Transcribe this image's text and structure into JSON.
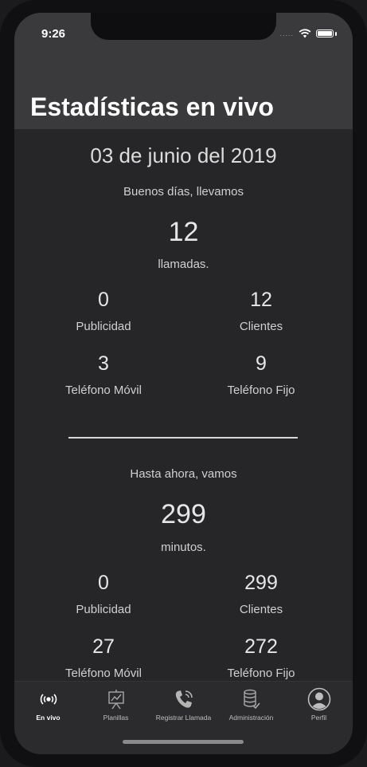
{
  "status_bar": {
    "time": "9:26",
    "signal": "....."
  },
  "header": {
    "title": "Estadísticas en vivo"
  },
  "main": {
    "date": "03 de junio del 2019",
    "calls": {
      "intro": "Buenos días, llevamos",
      "total": "12",
      "unit": "llamadas.",
      "stats": [
        {
          "value": "0",
          "label": "Publicidad"
        },
        {
          "value": "12",
          "label": "Clientes"
        },
        {
          "value": "3",
          "label": "Teléfono Móvil"
        },
        {
          "value": "9",
          "label": "Teléfono Fijo"
        }
      ]
    },
    "minutes": {
      "intro": "Hasta ahora, vamos",
      "total": "299",
      "unit": "minutos.",
      "stats": [
        {
          "value": "0",
          "label": "Publicidad"
        },
        {
          "value": "299",
          "label": "Clientes"
        },
        {
          "value": "27",
          "label": "Teléfono Móvil"
        },
        {
          "value": "272",
          "label": "Teléfono Fijo"
        }
      ]
    }
  },
  "tabbar": {
    "active": "En vivo",
    "tabs": [
      {
        "label": "En vivo",
        "icon": "live-broadcast-icon"
      },
      {
        "label": "Planillas",
        "icon": "presentation-chart-icon"
      },
      {
        "label": "Registrar Llamada",
        "icon": "phone-ringing-icon"
      },
      {
        "label": "Administración",
        "icon": "database-check-icon"
      },
      {
        "label": "Perfil",
        "icon": "user-circle-icon"
      }
    ]
  }
}
